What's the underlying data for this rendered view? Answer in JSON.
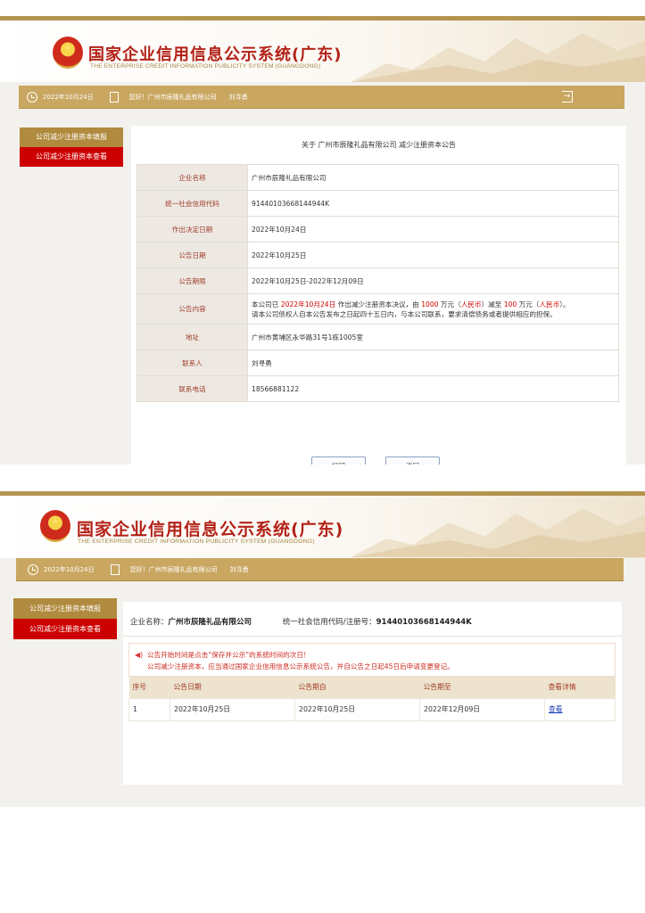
{
  "site": {
    "title": "国家企业信用信息公示系统(广东)",
    "subtitle": "THE ENTERPRISE CREDIT INFORMATION PUBLICITY SYSTEM (GUANGDONG)"
  },
  "infobar": {
    "date": "2022年10月24日",
    "greeting": "您好！广州市辰隆礼品有限公司",
    "user": "刘寻勇"
  },
  "sidebar": {
    "items": [
      {
        "label": "公司减少注册资本填报"
      },
      {
        "label": "公司减少注册资本查看"
      }
    ]
  },
  "notice": {
    "title": "关于 广州市辰隆礼品有限公司 减少注册资本公告",
    "rows": [
      {
        "label": "企业名称",
        "value": "广州市辰隆礼品有限公司"
      },
      {
        "label": "统一社会信用代码",
        "value": "91440103668144944K"
      },
      {
        "label": "作出决定日期",
        "value": "2022年10月24日"
      },
      {
        "label": "公告日期",
        "value": "2022年10月25日"
      },
      {
        "label": "公告期限",
        "value": "2022年10月25日-2022年12月09日"
      }
    ],
    "content": {
      "label": "公告内容",
      "p1": "本公司已 ",
      "date": "2022年10月24日",
      "p2": " 作出减少注册资本决议，由 ",
      "from": "1000",
      "p3": " 万元（",
      "cur1": "人民币",
      "p4": "）减至 ",
      "to": "100",
      "p5": " 万元（",
      "cur2": "人民币",
      "p6": "）。",
      "line2": "请本公司债权人自本公告发布之日起四十五日内，与本公司联系，要求清偿债务或者提供相应的担保。"
    },
    "rows2": [
      {
        "label": "地址",
        "value": "广州市黄埔区永华路31号1栋1005室"
      },
      {
        "label": "联系人",
        "value": "刘寻勇"
      },
      {
        "label": "联系电话",
        "value": "18566881122"
      }
    ],
    "print_label": "打印",
    "back_label": "返回"
  },
  "view": {
    "company_label": "企业名称：",
    "company_name": "广州市辰隆礼品有限公司",
    "code_label": "统一社会信用代码/注册号：",
    "code": "91440103668144944K",
    "alert_line1": "公告开始时间是点击“保存并公示”的系统时间的次日！",
    "alert_line2": "公司减少注册资本，应当通过国家企业信用信息公示系统公告，并自公告之日起45日后申请变更登记。",
    "columns": [
      "序号",
      "公告日期",
      "公告期自",
      "公告期至",
      "查看详情"
    ],
    "rows": [
      {
        "no": "1",
        "date": "2022年10月25日",
        "from": "2022年10月25日",
        "to": "2022年12月09日",
        "link": "查看"
      }
    ]
  },
  "colors": {
    "brand_gold": "#c9a761",
    "brand_red": "#b32117",
    "active_red": "#cc0000"
  }
}
